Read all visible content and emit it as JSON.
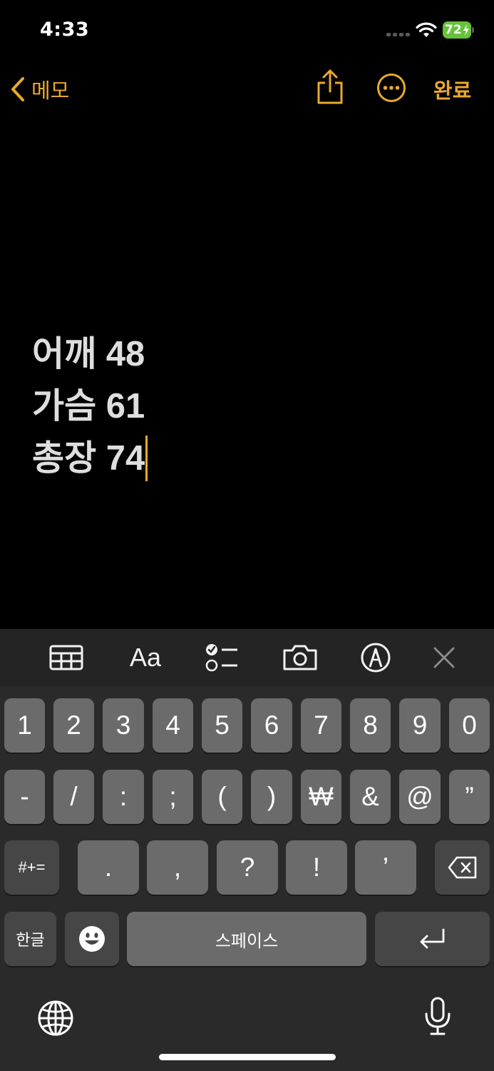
{
  "status": {
    "time": "4:33",
    "battery": "72"
  },
  "nav": {
    "back_label": "메모",
    "done_label": "완료"
  },
  "note": {
    "lines": [
      "어깨 48",
      "가슴 61",
      "총장 74"
    ]
  },
  "toolbar": {
    "text_format_label": "Aa"
  },
  "keyboard": {
    "row1": [
      "1",
      "2",
      "3",
      "4",
      "5",
      "6",
      "7",
      "8",
      "9",
      "0"
    ],
    "row2": [
      "-",
      "/",
      ":",
      ";",
      "(",
      ")",
      "₩",
      "&",
      "@",
      "”"
    ],
    "row3": {
      "mode": "#+=",
      "keys": [
        ".",
        ",",
        "?",
        "!",
        "’"
      ]
    },
    "row4": {
      "lang": "한글",
      "space": "스페이스"
    }
  },
  "colors": {
    "accent": "#e8a92f",
    "key": "#6b6b6b",
    "key_dark": "#464646",
    "keyboard_bg": "#2a2a2a"
  }
}
